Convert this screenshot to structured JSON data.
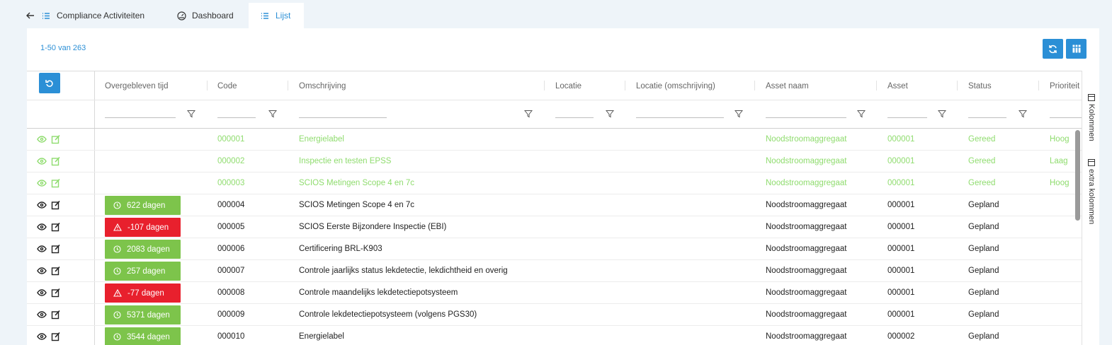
{
  "tabs": {
    "back_label": "Compliance Activiteiten",
    "dashboard_label": "Dashboard",
    "list_label": "Lijst"
  },
  "pager": {
    "count_text": "1-50 van 263"
  },
  "columns": {
    "remaining": "Overgebleven tijd",
    "code": "Code",
    "description": "Omschrijving",
    "location": "Locatie",
    "location_desc": "Locatie (omschrijving)",
    "asset_name": "Asset naam",
    "asset": "Asset",
    "status": "Status",
    "priority": "Prioriteit"
  },
  "side_panel": {
    "columns_label": "Kolommen",
    "extra_columns_label": "extra kolommen"
  },
  "colors": {
    "accent": "#2b8fd6",
    "done": "#8fdc6e",
    "ok_badge": "#7dc44b",
    "late_badge": "#e8202d"
  },
  "rows": [
    {
      "done": true,
      "remaining": "",
      "badge": "",
      "code": "000001",
      "description": "Energielabel",
      "asset_name": "Noodstroomaggregaat",
      "asset": "000001",
      "status": "Gereed",
      "priority": "Hoog"
    },
    {
      "done": true,
      "remaining": "",
      "badge": "",
      "code": "000002",
      "description": "Inspectie en testen EPSS",
      "asset_name": "Noodstroomaggregaat",
      "asset": "000001",
      "status": "Gereed",
      "priority": "Laag"
    },
    {
      "done": true,
      "remaining": "",
      "badge": "",
      "code": "000003",
      "description": "SCIOS Metingen Scope 4 en 7c",
      "asset_name": "Noodstroomaggregaat",
      "asset": "000001",
      "status": "Gereed",
      "priority": "Hoog"
    },
    {
      "done": false,
      "remaining": "622 dagen",
      "badge": "green",
      "code": "000004",
      "description": "SCIOS Metingen Scope 4 en 7c",
      "asset_name": "Noodstroomaggregaat",
      "asset": "000001",
      "status": "Gepland",
      "priority": ""
    },
    {
      "done": false,
      "remaining": "-107 dagen",
      "badge": "red",
      "code": "000005",
      "description": "SCIOS Eerste Bijzondere Inspectie (EBI)",
      "asset_name": "Noodstroomaggregaat",
      "asset": "000001",
      "status": "Gepland",
      "priority": ""
    },
    {
      "done": false,
      "remaining": "2083 dagen",
      "badge": "green",
      "code": "000006",
      "description": "Certificering BRL-K903",
      "asset_name": "Noodstroomaggregaat",
      "asset": "000001",
      "status": "Gepland",
      "priority": ""
    },
    {
      "done": false,
      "remaining": "257 dagen",
      "badge": "green",
      "code": "000007",
      "description": "Controle jaarlijks status lekdetectie, lekdichtheid en overig",
      "asset_name": "Noodstroomaggregaat",
      "asset": "000001",
      "status": "Gepland",
      "priority": ""
    },
    {
      "done": false,
      "remaining": "-77 dagen",
      "badge": "red",
      "code": "000008",
      "description": "Controle maandelijks lekdetectiepotsysteem",
      "asset_name": "Noodstroomaggregaat",
      "asset": "000001",
      "status": "Gepland",
      "priority": ""
    },
    {
      "done": false,
      "remaining": "5371 dagen",
      "badge": "green",
      "code": "000009",
      "description": "Controle lekdetectiepotsysteem (volgens PGS30)",
      "asset_name": "Noodstroomaggregaat",
      "asset": "000001",
      "status": "Gepland",
      "priority": ""
    },
    {
      "done": false,
      "remaining": "3544 dagen",
      "badge": "green",
      "code": "000010",
      "description": "Energielabel",
      "asset_name": "Noodstroomaggregaat",
      "asset": "000002",
      "status": "Gepland",
      "priority": ""
    }
  ]
}
